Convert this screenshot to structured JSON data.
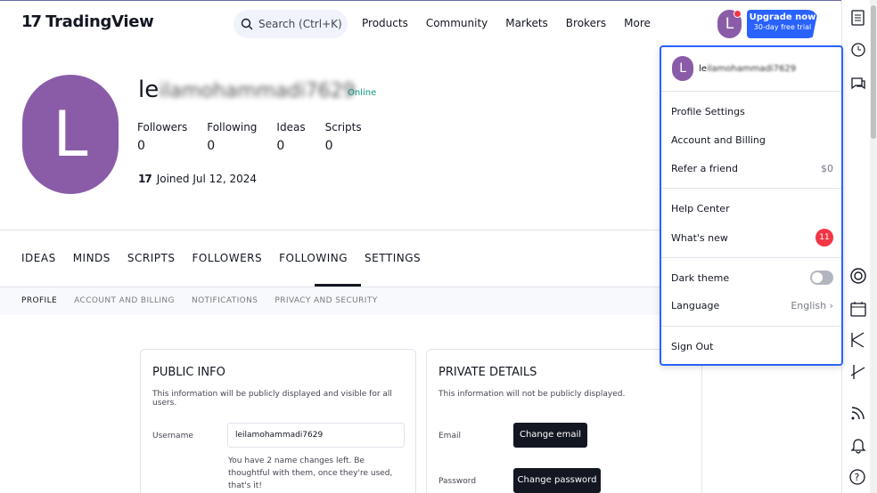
{
  "header": {
    "logo_mark": "17",
    "logo_text": "TradingView",
    "search_placeholder": "Search (Ctrl+K)",
    "nav": [
      "Products",
      "Community",
      "Markets",
      "Brokers",
      "More"
    ],
    "avatar_letter": "L",
    "upgrade_label": "Upgrade now",
    "upgrade_sub": "30-day free trial"
  },
  "profile": {
    "avatar_letter": "L",
    "username_visible": "le",
    "username_blurred": "ilamohammadi7629",
    "status": "Online",
    "stats": [
      {
        "label": "Followers",
        "value": "0"
      },
      {
        "label": "Following",
        "value": "0"
      },
      {
        "label": "Ideas",
        "value": "0"
      },
      {
        "label": "Scripts",
        "value": "0"
      }
    ],
    "joined_mark": "17",
    "joined": "Joined Jul 12, 2024"
  },
  "tabs": [
    "IDEAS",
    "MINDS",
    "SCRIPTS",
    "FOLLOWERS",
    "FOLLOWING",
    "SETTINGS"
  ],
  "subnav": [
    "PROFILE",
    "ACCOUNT AND BILLING",
    "NOTIFICATIONS",
    "PRIVACY AND SECURITY"
  ],
  "public_info": {
    "title": "PUBLIC INFO",
    "desc": "This information will be publicly displayed and visible for all users.",
    "username_label": "Username",
    "username_value": "leilamohammadi7629",
    "hint": "You have 2 name changes left. Be thoughtful with them, once they're used, that's it!"
  },
  "private_details": {
    "title": "PRIVATE DETAILS",
    "desc": "This information will not be publicly displayed.",
    "email_label": "Email",
    "email_button": "Change email",
    "password_label": "Password",
    "password_button": "Change password"
  },
  "menu": {
    "avatar_letter": "L",
    "name_visible": "le",
    "name_blurred": "ilamohammadi7629",
    "profile_settings": "Profile Settings",
    "account_billing": "Account and Billing",
    "refer": "Refer a friend",
    "refer_value": "$0",
    "help": "Help Center",
    "whats_new": "What's new",
    "whats_new_count": "11",
    "dark_theme": "Dark theme",
    "language": "Language",
    "language_value": "English",
    "sign_out": "Sign Out"
  },
  "colors": {
    "avatar": "#8a5ca8",
    "accent": "#2962ff",
    "online": "#089981",
    "badge": "#f23645"
  }
}
